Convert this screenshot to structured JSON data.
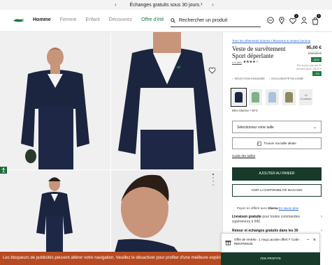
{
  "topbar": {
    "message": "Échanges gratuits sous 30 jours.¹"
  },
  "nav": {
    "homme": "Homme",
    "femme": "Femme",
    "enfant": "Enfant",
    "decouvrez": "Découvrez",
    "offre": "Offre d'été"
  },
  "search": {
    "placeholder": "Rechercher un produit"
  },
  "header": {
    "wishlist_count": "1",
    "cart_count": "0"
  },
  "product": {
    "breadcrumb": "Tous les vêtements homme  /  Blousons & Vestes homme",
    "title": "Veste de survêtement Sport déperlante",
    "price": "95,00 €",
    "old_price": "160,00 €",
    "discount": "-40%",
    "lowest_price_note": "Prix le plus bas des 30 derniers jours : 95,00 €",
    "discount2": "-7%",
    "rating_count": "4.6 (56)",
    "features": [
      "SÉLECTION ENGAGÉE",
      "EXCLUSIVITÉ EN LIGNE"
    ],
    "more_colors": "+3 Couleurs",
    "color_name": "Bleu Marine • SFS",
    "size_select": "Sélectionnez votre taille",
    "fit_button": "Trouver ma taille idéale",
    "size_guide": "Guide des tailles",
    "add_to_cart": "AJOUTER AU PANIER",
    "availability": "VOIR LA DISPONIBILITÉ MAGASIN",
    "klarna_pre": "Payez en différé avec ",
    "klarna_brand": "Klarna",
    "klarna_link": "En savoir plus",
    "shipping_bold": "Livraison gratuite",
    "shipping_rest": " pour toutes commandes supérieures à 99€.",
    "returns": "Retour et échanges gratuits dans les 30"
  },
  "promo": {
    "text": "Offre de rentrée : 1 mug Lacoste offert !* Code : RENTREE26",
    "button": "J'EN PROFITE"
  },
  "adblock": {
    "message": "Les bloqueurs de publicités peuvent altérer votre navigation. Veuillez le désactiver pour profiter d'une meilleure expérience"
  },
  "colors": {
    "accent_green": "#1c7a3e",
    "dark_green": "#173a2a",
    "warning": "#b74a20"
  },
  "swatches": [
    "#1b2540",
    "#7fb089",
    "#a9c3dc",
    "#8f8a5c"
  ]
}
